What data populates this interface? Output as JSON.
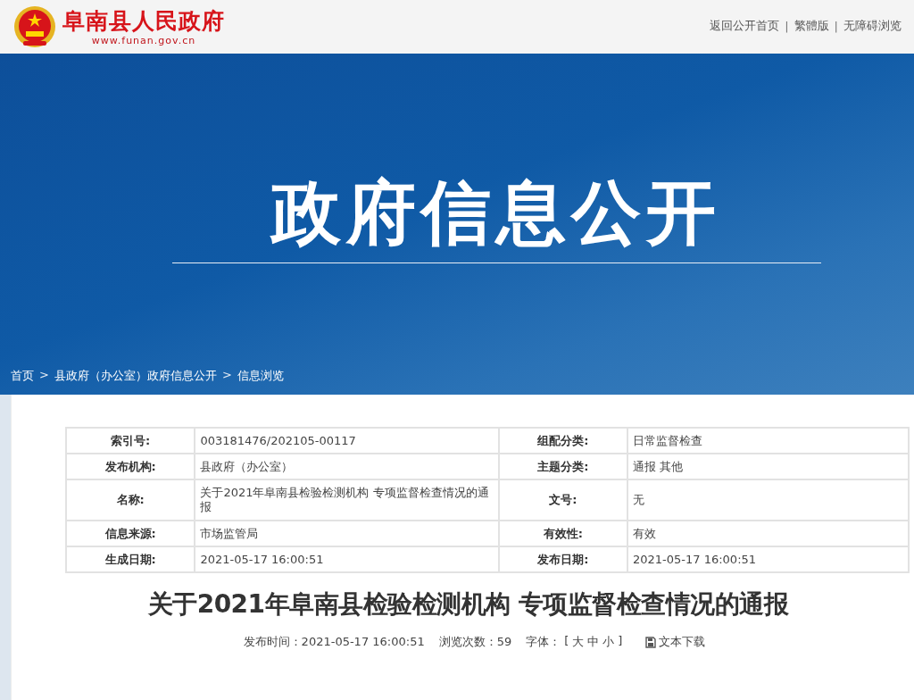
{
  "header": {
    "site_name": "阜南县人民政府",
    "site_url": "www.funan.gov.cn",
    "links": [
      {
        "kind": "link",
        "text": "返回公开首页"
      },
      {
        "kind": "separator",
        "text": "|"
      },
      {
        "kind": "link",
        "text": "繁體版"
      },
      {
        "kind": "separator",
        "text": "|"
      },
      {
        "kind": "link",
        "text": "无障碍浏览"
      }
    ]
  },
  "banner": {
    "title": "政府信息公开"
  },
  "breadcrumb": [
    {
      "kind": "link",
      "text": "首页"
    },
    {
      "kind": "separator",
      "text": ">"
    },
    {
      "kind": "link",
      "text": "县政府（办公室）政府信息公开"
    },
    {
      "kind": "separator",
      "text": ">"
    },
    {
      "kind": "link",
      "text": "信息浏览"
    }
  ],
  "info_table": {
    "rows": [
      [
        {
          "label": "索引号:",
          "value": "003181476/202105-00117"
        },
        {
          "label": "组配分类:",
          "value": "日常监督检查"
        }
      ],
      [
        {
          "label": "发布机构:",
          "value": "县政府（办公室）"
        },
        {
          "label": "主题分类:",
          "value": "通报  其他"
        }
      ],
      [
        {
          "label": "名称:",
          "value": "关于2021年阜南县检验检测机构 专项监督检查情况的通报"
        },
        {
          "label": "文号:",
          "value": "无"
        }
      ],
      [
        {
          "label": "信息来源:",
          "value": "市场监管局"
        },
        {
          "label": "有效性:",
          "value": "有效"
        }
      ],
      [
        {
          "label": "生成日期:",
          "value": "2021-05-17 16:00:51"
        },
        {
          "label": "发布日期:",
          "value": "2021-05-17 16:00:51"
        }
      ]
    ]
  },
  "article": {
    "title": "关于2021年阜南县检验检测机构 专项监督检查情况的通报",
    "meta": {
      "publish_time": "发布时间：2021-05-17 16:00:51",
      "views": "浏览次数：59",
      "font_label": "字体：",
      "font_open": "[",
      "font_sizes": [
        "大",
        "中",
        "小"
      ],
      "font_close": "]",
      "download": "文本下载"
    }
  }
}
